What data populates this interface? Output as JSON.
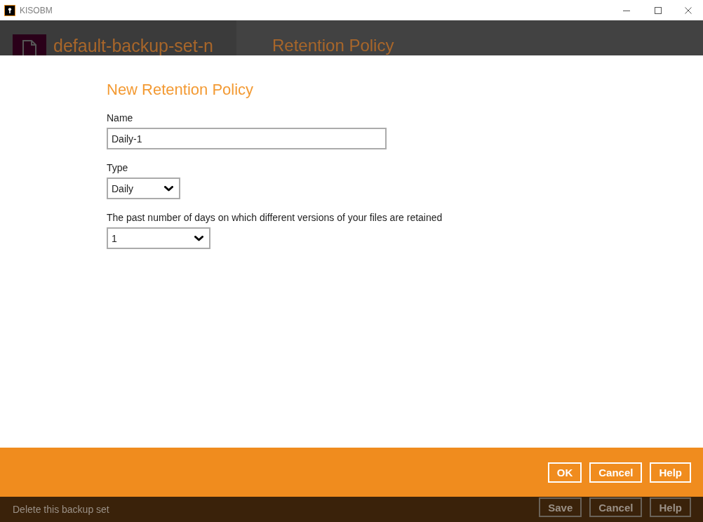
{
  "window": {
    "title": "KISOBM"
  },
  "backup_set": {
    "name": "default-backup-set-n",
    "page_title": "Retention Policy"
  },
  "dialog": {
    "title": "New Retention Policy",
    "fields": [
      {
        "kind": "text",
        "label": "Name",
        "value": "Daily-1"
      },
      {
        "kind": "dropdown",
        "label": "Type",
        "value": "Daily"
      },
      {
        "kind": "dropdown",
        "label": "The past number of days on which different versions of your files are retained",
        "value": "1"
      }
    ],
    "buttons": [
      "OK",
      "Cancel",
      "Help"
    ]
  },
  "footer": {
    "link": "Delete this backup set",
    "buttons": [
      "Save",
      "Cancel",
      "Help"
    ]
  }
}
